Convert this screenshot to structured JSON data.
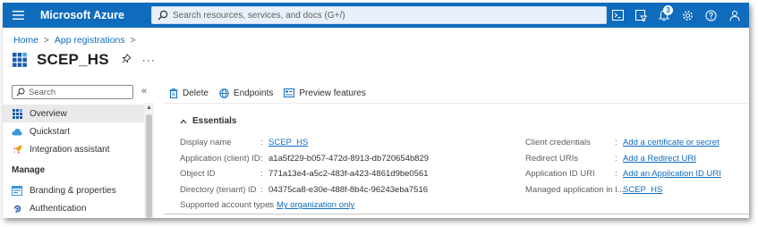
{
  "topbar": {
    "brand": "Microsoft Azure",
    "search_placeholder": "Search resources, services, and docs (G+/)",
    "notification_count": "3",
    "icons": [
      "cloud-shell-icon",
      "directory-filter-icon",
      "notifications-icon",
      "settings-icon",
      "help-icon",
      "feedback-icon"
    ]
  },
  "breadcrumb": {
    "home": "Home",
    "app_registrations": "App registrations"
  },
  "page": {
    "title": "SCEP_HS",
    "more": "···"
  },
  "nav": {
    "search_placeholder": "Search",
    "collapse": "«",
    "items": [
      {
        "label": "Overview",
        "icon": "overview-grid-icon",
        "active": true
      },
      {
        "label": "Quickstart",
        "icon": "quickstart-cloud-icon"
      },
      {
        "label": "Integration assistant",
        "icon": "rocket-icon"
      }
    ],
    "section_manage": "Manage",
    "manage_items": [
      {
        "label": "Branding & properties",
        "icon": "branding-icon"
      },
      {
        "label": "Authentication",
        "icon": "authentication-icon"
      }
    ]
  },
  "toolbar": {
    "delete": "Delete",
    "endpoints": "Endpoints",
    "preview": "Preview features"
  },
  "essentials": {
    "heading": "Essentials",
    "left": [
      {
        "label": "Display name",
        "value": "SCEP_HS",
        "link": true
      },
      {
        "label": "Application (client) ID",
        "value": "a1a5f229-b057-472d-8913-db720654b829",
        "link": false
      },
      {
        "label": "Object ID",
        "value": "771a13e4-a5c2-483f-a423-4861d9be0561",
        "link": false
      },
      {
        "label": "Directory (tenant) ID",
        "value": "04375ca8-e30e-488f-8b4c-96243eba7516",
        "link": false
      },
      {
        "label": "Supported account types",
        "value": "My organization only",
        "link": true
      }
    ],
    "right": [
      {
        "label": "Client credentials",
        "value": "Add a certificate or secret",
        "link": true
      },
      {
        "label": "Redirect URIs",
        "value": "Add a Redirect URI",
        "link": true
      },
      {
        "label": "Application ID URI",
        "value": "Add an Application ID URI",
        "link": true
      },
      {
        "label": "Managed application in l...",
        "value": "SCEP_HS",
        "link": true
      }
    ]
  },
  "colors": {
    "topbar": "#0f6cbd",
    "link": "#0f6cbd"
  }
}
